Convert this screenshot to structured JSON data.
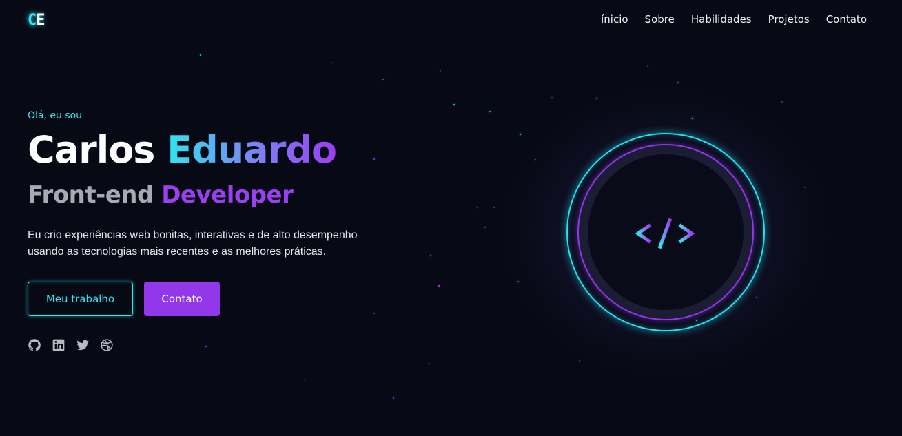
{
  "header": {
    "logo": {
      "c": "C",
      "e": "E"
    },
    "nav": [
      "ínicio",
      "Sobre",
      "Habilidades",
      "Projetos",
      "Contato"
    ]
  },
  "hero": {
    "greeting": "Olá, eu sou",
    "first_name": "Carlos",
    "last_name": "Eduardo",
    "role_prefix": "Front-end",
    "role_highlight": "Developer",
    "description": "Eu crio experiências web bonitas, interativas e de alto desempenho usando as tecnologias mais recentes e as melhores práticas.",
    "primary_button": "Meu trabalho",
    "secondary_button": "Contato"
  },
  "socials": [
    "github-icon",
    "linkedin-icon",
    "twitter-icon",
    "dribbble-icon"
  ],
  "colors": {
    "background": "#070914",
    "cyan_accent": "#2ee6f0",
    "purple_accent": "#9237ea",
    "text": "#ffffff",
    "muted_text": "#a8a9b3"
  }
}
